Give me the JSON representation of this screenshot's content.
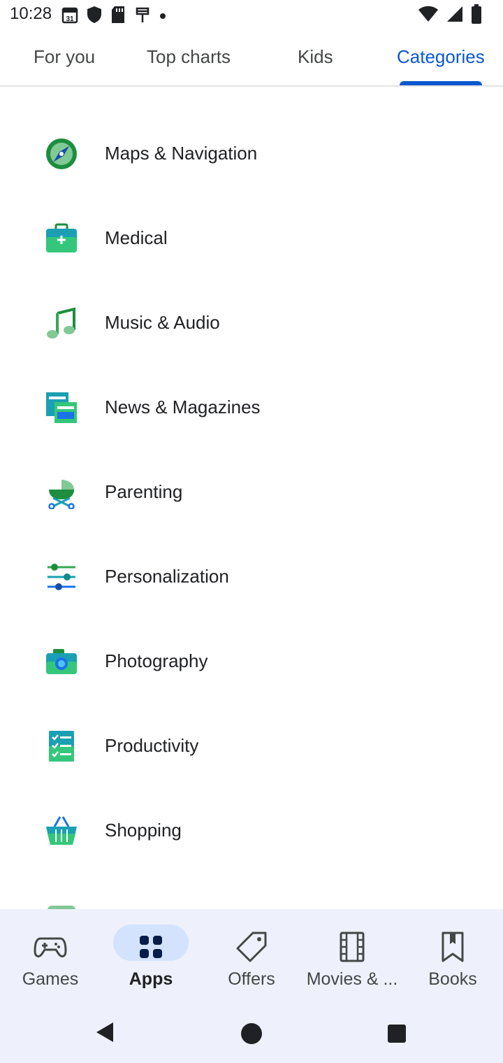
{
  "status_bar": {
    "time": "10:28",
    "icons": [
      "calendar-31-icon",
      "shield-icon",
      "sd-card-icon",
      "usb-icon",
      "dot-icon",
      "wifi-icon",
      "signal-icon",
      "battery-icon"
    ]
  },
  "top_tabs": [
    {
      "label": "For you"
    },
    {
      "label": "Top charts"
    },
    {
      "label": "Kids"
    },
    {
      "label": "Categories"
    }
  ],
  "categories": [
    {
      "label": "Maps & Navigation",
      "icon": "compass-icon"
    },
    {
      "label": "Medical",
      "icon": "medical-kit-icon"
    },
    {
      "label": "Music & Audio",
      "icon": "music-note-icon"
    },
    {
      "label": "News & Magazines",
      "icon": "newspaper-icon"
    },
    {
      "label": "Parenting",
      "icon": "stroller-icon"
    },
    {
      "label": "Personalization",
      "icon": "sliders-icon"
    },
    {
      "label": "Photography",
      "icon": "camera-icon"
    },
    {
      "label": "Productivity",
      "icon": "checklist-icon"
    },
    {
      "label": "Shopping",
      "icon": "basket-icon"
    }
  ],
  "bottom_nav": [
    {
      "label": "Games",
      "icon": "gamepad-icon"
    },
    {
      "label": "Apps",
      "icon": "apps-grid-icon"
    },
    {
      "label": "Offers",
      "icon": "tag-icon"
    },
    {
      "label": "Movies & ...",
      "icon": "film-icon"
    },
    {
      "label": "Books",
      "icon": "bookmark-icon"
    }
  ],
  "colors": {
    "accent": "#0b57d0",
    "nav_background": "#eef1fb",
    "active_pill": "#d3e3fd"
  }
}
